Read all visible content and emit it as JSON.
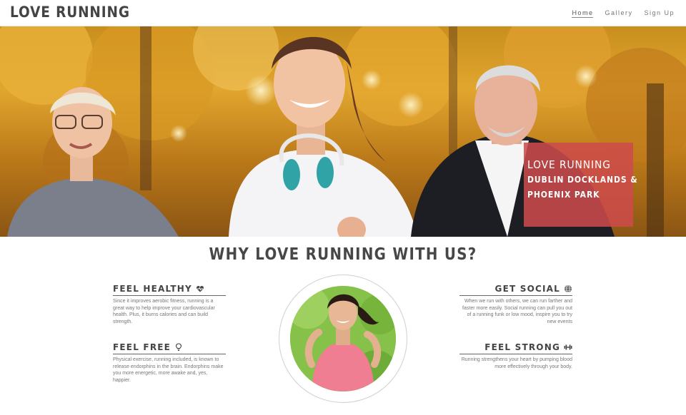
{
  "header": {
    "brand": "LOVE RUNNING",
    "nav": [
      {
        "label": "Home",
        "active": true
      },
      {
        "label": "Gallery",
        "active": false
      },
      {
        "label": "Sign Up",
        "active": false
      }
    ]
  },
  "hero": {
    "card_title": "LOVE RUNNING",
    "card_subtitle_1": "DUBLIN DOCKLANDS &",
    "card_subtitle_2": "PHOENIX PARK"
  },
  "section": {
    "title": "WHY LOVE RUNNING WITH US?",
    "features": {
      "healthy": {
        "title": "FEEL HEALTHY",
        "icon": "heartbeat-icon",
        "text": "Since it improves aerobic fitness, running is a great way to help improve your cardiovascular health. Plus, it burns calories and can build strength."
      },
      "free": {
        "title": "FEEL FREE",
        "icon": "lightbulb-icon",
        "text": "Physical exercise, running included, is known to release endorphins in the brain. Endorphins make you more energetic, more awake and, yes, happier."
      },
      "social": {
        "title": "GET SOCIAL",
        "icon": "globe-icon",
        "text": "When we run with others, we can run farther and faster more easily. Social running can pull you out of a running funk or low mood, inspire you to try new events"
      },
      "strong": {
        "title": "FEEL STRONG",
        "icon": "dumbbell-icon",
        "text": "Running strengthens your heart by pumping blood more effectively through your body."
      }
    }
  },
  "colors": {
    "card_bg": "#cd4b4b",
    "text_dark": "#444444",
    "text_muted": "#777777"
  }
}
